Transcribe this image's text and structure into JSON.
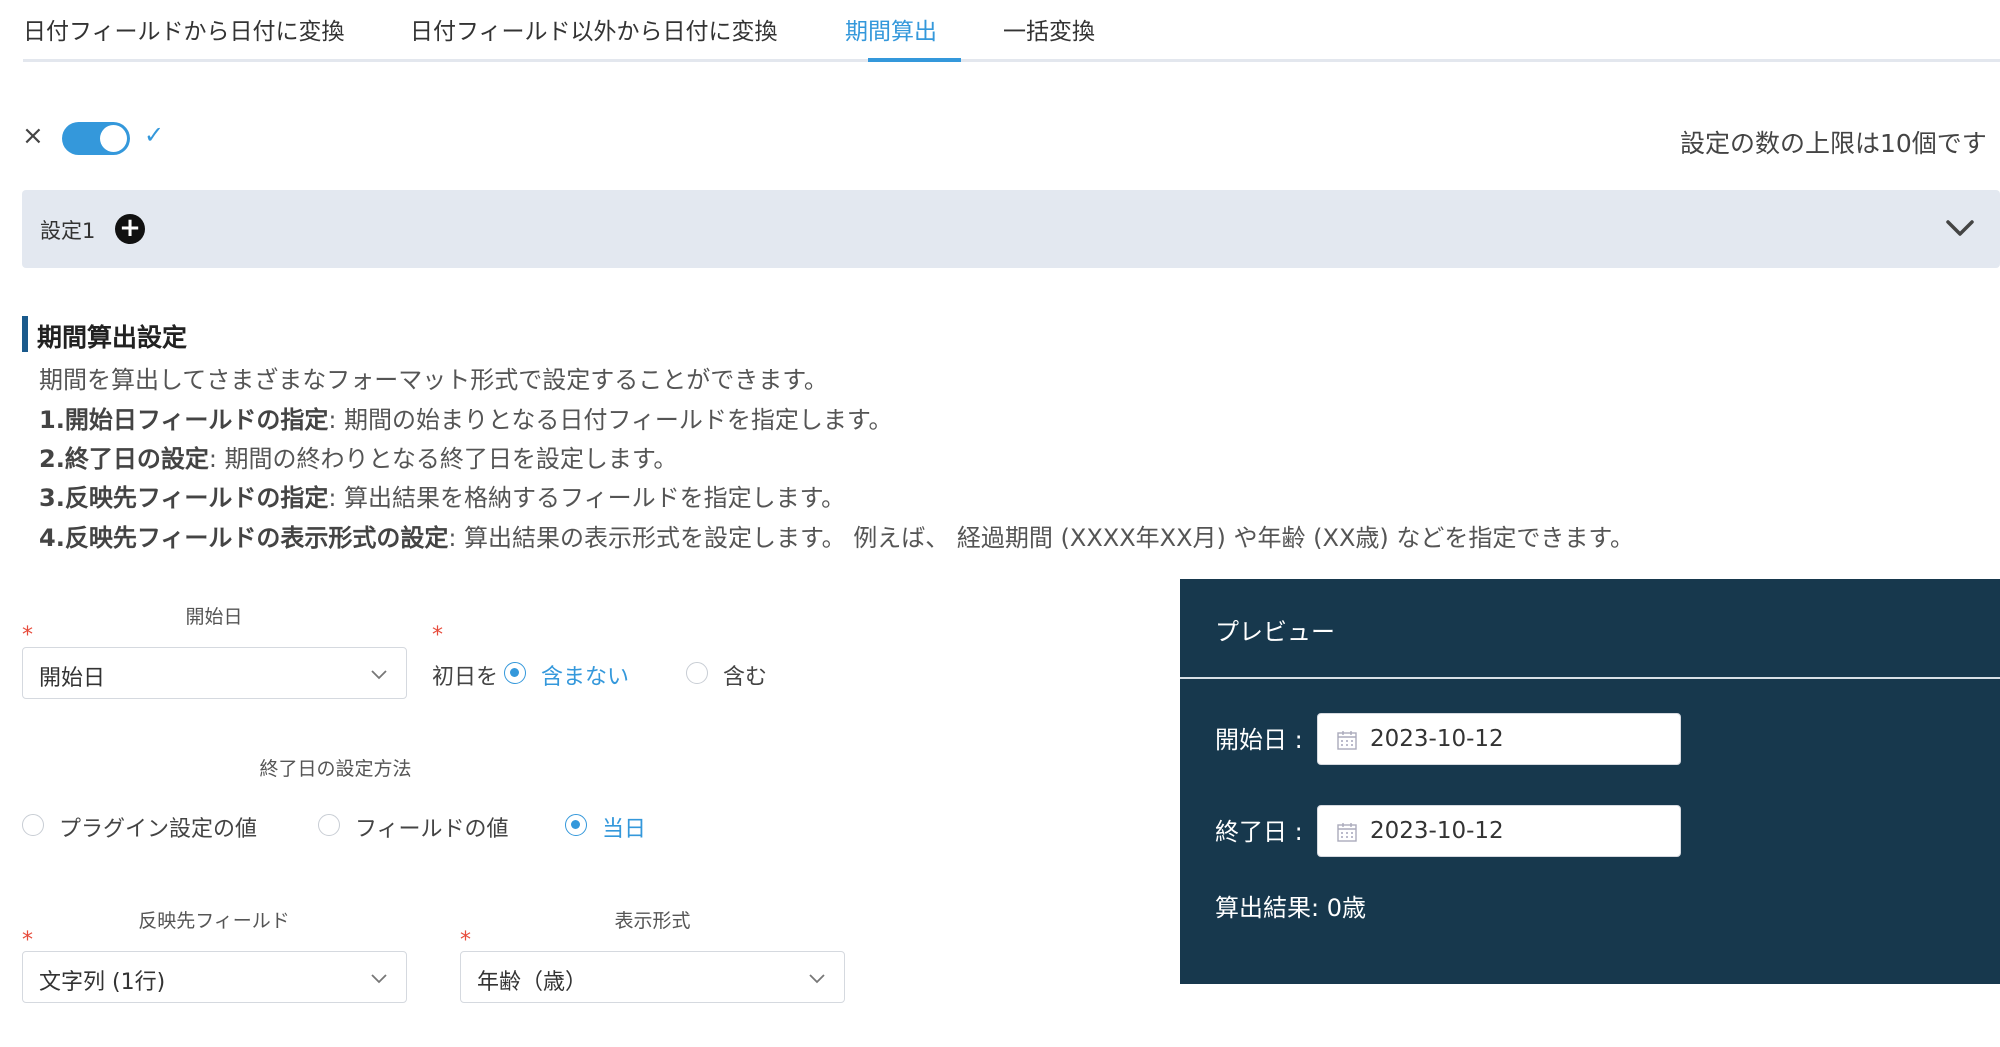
{
  "tabs": [
    {
      "label": "日付フィールドから日付に変換"
    },
    {
      "label": "日付フィールド以外から日付に変換"
    },
    {
      "label": "期間算出"
    },
    {
      "label": "一括変換"
    }
  ],
  "toggle": {
    "off_glyph": "×",
    "on_glyph": "✓",
    "enabled": true
  },
  "limit_text": "設定の数の上限は10個です",
  "accordion": {
    "label": "設定1",
    "add_glyph": "+"
  },
  "section": {
    "title": "期間算出設定",
    "intro": "期間を算出してさまざまなフォーマット形式で設定することができます。",
    "items": [
      {
        "bold": "1.開始日フィールドの指定",
        "text": ": 期間の始まりとなる日付フィールドを指定します。"
      },
      {
        "bold": "2.終了日の設定",
        "text": ": 期間の終わりとなる終了日を設定します。"
      },
      {
        "bold": "3.反映先フィールドの指定",
        "text": ": 算出結果を格納するフィールドを指定します。"
      },
      {
        "bold": "4.反映先フィールドの表示形式の設定",
        "text": ": 算出結果の表示形式を設定します。 例えば、 経過期間 (XXXX年XX月) や年齢 (XX歳) などを指定できます。"
      }
    ]
  },
  "form": {
    "start_label": "開始日",
    "start_value": "開始日",
    "first_day_prefix": "初日を",
    "first_day_options": [
      {
        "label": "含まない",
        "selected": true
      },
      {
        "label": "含む",
        "selected": false
      }
    ],
    "end_method_label": "終了日の設定方法",
    "end_method_options": [
      {
        "label": "プラグイン設定の値",
        "selected": false
      },
      {
        "label": "フィールドの値",
        "selected": false
      },
      {
        "label": "当日",
        "selected": true
      }
    ],
    "target_label": "反映先フィールド",
    "target_value": "文字列 (1行)",
    "format_label": "表示形式",
    "format_value": "年齢（歳）",
    "required_mark": "*"
  },
  "preview": {
    "title": "プレビュー",
    "start_label": "開始日 :",
    "start_value": "2023-10-12",
    "end_label": "終了日 :",
    "end_value": "2023-10-12",
    "result": "算出結果: 0歳"
  },
  "colors": {
    "accent": "#3498db",
    "panel": "#17384d",
    "accordion": "#e3e8f0",
    "required": "#e74c3c"
  }
}
